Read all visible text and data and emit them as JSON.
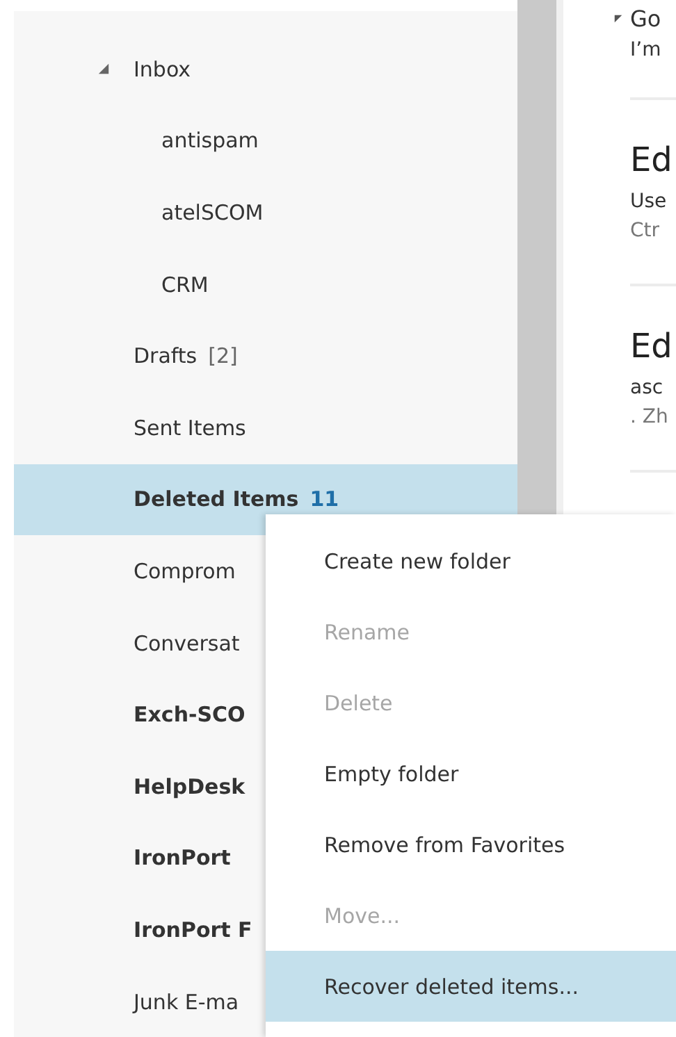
{
  "folders": [
    {
      "label": "Inbox",
      "expanded": true,
      "bold": false,
      "selected": false,
      "children": [
        {
          "label": "antispam",
          "bold": false,
          "selected": false
        },
        {
          "label": "atelSCOM",
          "bold": false,
          "selected": false
        },
        {
          "label": "CRM",
          "bold": false,
          "selected": false
        }
      ]
    },
    {
      "label": "Drafts",
      "count": "[2]",
      "bold": false,
      "selected": false
    },
    {
      "label": "Sent Items",
      "bold": false,
      "selected": false
    },
    {
      "label": "Deleted Items",
      "count": "11",
      "bold": true,
      "selected": true
    },
    {
      "label": "Comprom",
      "bold": false,
      "selected": false
    },
    {
      "label": "Conversat",
      "bold": false,
      "selected": false
    },
    {
      "label": "Exch-SCO",
      "bold": true,
      "selected": false
    },
    {
      "label": "HelpDesk",
      "bold": true,
      "selected": false
    },
    {
      "label": "IronPort",
      "bold": true,
      "selected": false
    },
    {
      "label": "IronPort F",
      "bold": true,
      "selected": false
    },
    {
      "label": "Junk E-ma",
      "bold": false,
      "selected": false
    }
  ],
  "messages": [
    {
      "kind": "conversation",
      "sender": "Go",
      "subject": "I’m"
    },
    {
      "kind": "message",
      "sender": "Ed",
      "subject": "Use",
      "preview": "Ctr"
    },
    {
      "kind": "message",
      "sender": "Ed",
      "subject": "asc",
      "preview": ". Zh"
    }
  ],
  "context_menu": [
    {
      "label": "Create new folder",
      "disabled": false,
      "selected": false
    },
    {
      "label": "Rename",
      "disabled": true,
      "selected": false
    },
    {
      "label": "Delete",
      "disabled": true,
      "selected": false
    },
    {
      "label": "Empty folder",
      "disabled": false,
      "selected": false
    },
    {
      "label": "Remove from Favorites",
      "disabled": false,
      "selected": false
    },
    {
      "label": "Move...",
      "disabled": true,
      "selected": false
    },
    {
      "label": "Recover deleted items...",
      "disabled": false,
      "selected": true
    }
  ]
}
